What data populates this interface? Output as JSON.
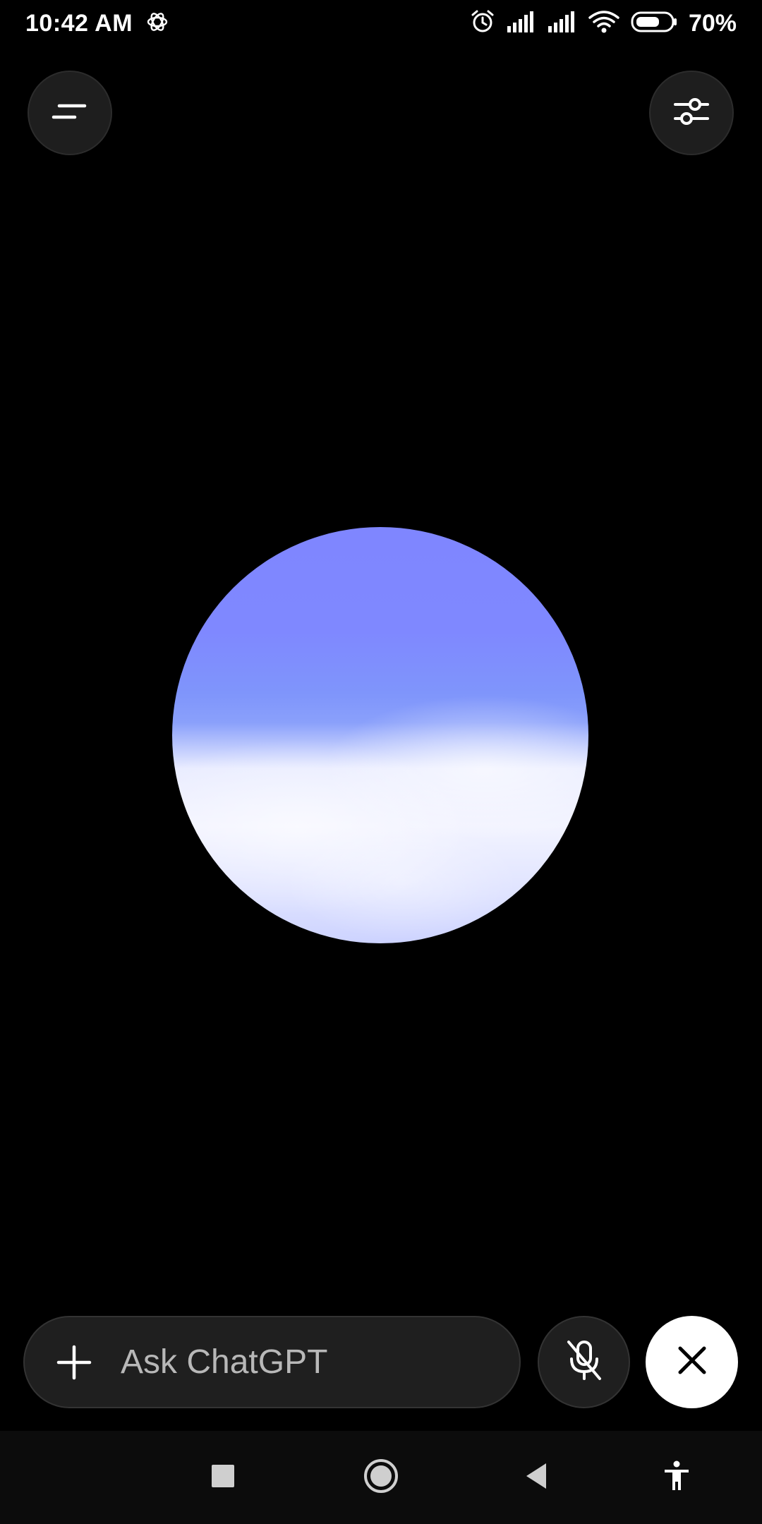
{
  "status_bar": {
    "time": "10:42 AM",
    "battery_percent": "70%",
    "battery_level": 0.7,
    "icons": [
      "chatgpt-logo-icon",
      "alarm-icon",
      "signal-icon",
      "signal-icon",
      "wifi-icon",
      "battery-icon"
    ]
  },
  "header": {
    "menu_icon": "menu-icon",
    "settings_icon": "sliders-icon"
  },
  "orb": {
    "top_color": "#7f86ff",
    "bottom_color": "#f2f3ff"
  },
  "input_bar": {
    "placeholder": "Ask ChatGPT",
    "plus_icon": "plus-icon",
    "mute_icon": "mic-off-icon",
    "close_icon": "close-icon"
  },
  "nav_bar": {
    "icons": [
      "recents-icon",
      "home-icon",
      "back-icon",
      "accessibility-icon"
    ]
  },
  "colors": {
    "background": "#000000",
    "button_bg": "#1f1f1f",
    "close_button_bg": "#ffffff"
  }
}
